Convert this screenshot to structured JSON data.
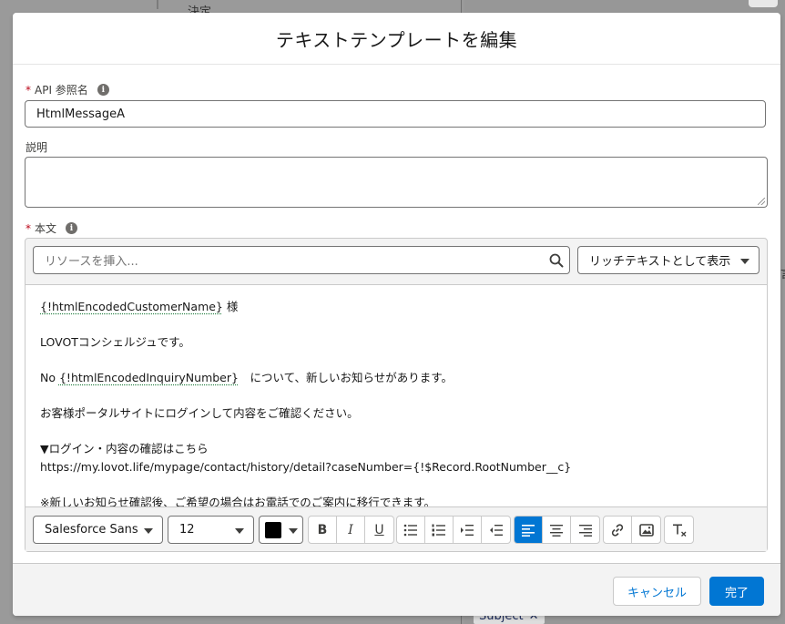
{
  "background": {
    "decision_label": "決定",
    "chip_label": "Subject",
    "chip_close": "✕",
    "right_edge_text": "言"
  },
  "modal": {
    "title": "テキストテンプレートを編集",
    "api_name": {
      "required_mark": "*",
      "label": "API 参照名",
      "value": "HtmlMessageA"
    },
    "description": {
      "label": "説明",
      "value": ""
    },
    "body": {
      "required_mark": "*",
      "label": "本文",
      "resource_placeholder": "リソースを挿入...",
      "display_mode": "リッチテキストとして表示",
      "content": {
        "line1_merge": "{!htmlEncodedCustomerName}",
        "line1_rest": " 様",
        "line2": "LOVOTコンシェルジュです。",
        "line3_prefix": "No ",
        "line3_merge": "{!htmlEncodedInquiryNumber}",
        "line3_rest": "　について、新しいお知らせがあります。",
        "line4": "お客様ポータルサイトにログインして内容をご確認ください。",
        "line5": "▼ログイン・内容の確認はこちら",
        "line6": "https://my.lovot.life/mypage/contact/history/detail?caseNumber={!$Record.RootNumber__c}",
        "line7": "※新しいお知らせ確認後、ご希望の場合はお電話でのご案内に移行できます。"
      }
    },
    "toolbar": {
      "font_family": "Salesforce Sans",
      "font_size": "12",
      "text_color": "#000000",
      "bold": "B",
      "italic": "I",
      "underline": "U"
    },
    "footer": {
      "cancel": "キャンセル",
      "done": "完了"
    }
  },
  "colors": {
    "brand": "#0176d3",
    "required": "#ba0517"
  }
}
